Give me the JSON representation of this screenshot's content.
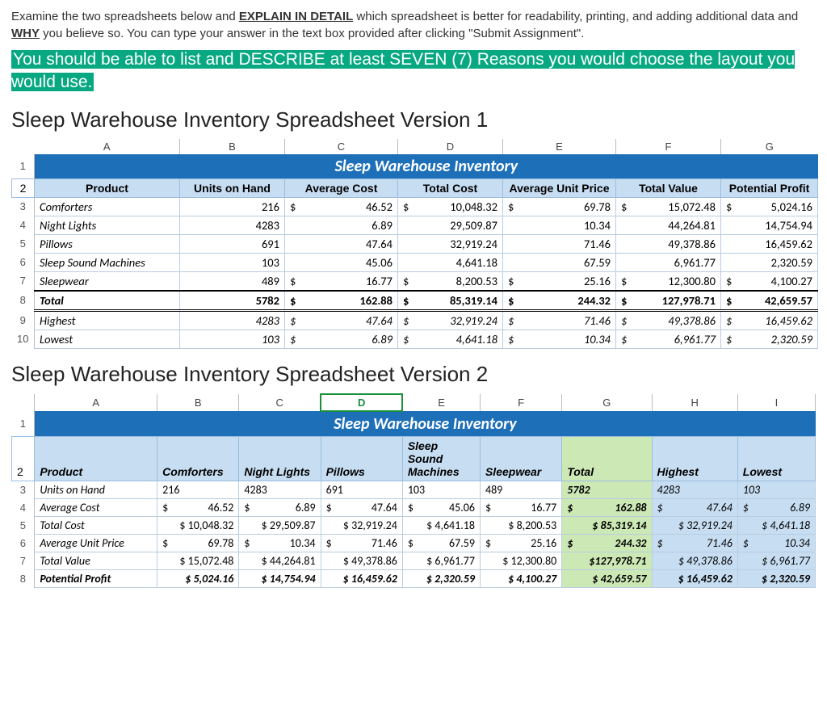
{
  "intro": {
    "p1a": "Examine the two spreadsheets below and ",
    "p1b": "EXPLAIN IN DETAIL",
    "p1c": " which spreadsheet is better for readability, printing, and adding additional data and ",
    "p1d": "WHY",
    "p1e": " you believe so. You can type your answer in the text box provided after clicking \"Submit Assignment\".",
    "hl": "You should be able to list and DESCRIBE at least SEVEN (7) Reasons you would choose the layout you would use."
  },
  "v1_heading": "Sleep Warehouse Inventory Spreadsheet Version 1",
  "v2_heading": "Sleep Warehouse Inventory Spreadsheet Version 2",
  "title": "Sleep Warehouse Inventory",
  "cols1": [
    "A",
    "B",
    "C",
    "D",
    "E",
    "F",
    "G"
  ],
  "cols2": [
    "A",
    "B",
    "C",
    "D",
    "E",
    "F",
    "G",
    "H",
    "I"
  ],
  "h1": {
    "product": "Product",
    "units": "Units on Hand",
    "avgcost": "Average Cost",
    "totalcost": "Total Cost",
    "avgprice": "Average Unit Price",
    "totalval": "Total Value",
    "profit": "Potential Profit"
  },
  "r3": {
    "n": "Comforters",
    "u": "216",
    "ac": "46.52",
    "tc": "10,048.32",
    "ap": "69.78",
    "tv": "15,072.48",
    "pp": "5,024.16"
  },
  "r4": {
    "n": "Night Lights",
    "u": "4283",
    "ac": "6.89",
    "tc": "29,509.87",
    "ap": "10.34",
    "tv": "44,264.81",
    "pp": "14,754.94"
  },
  "r5": {
    "n": "Pillows",
    "u": "691",
    "ac": "47.64",
    "tc": "32,919.24",
    "ap": "71.46",
    "tv": "49,378.86",
    "pp": "16,459.62"
  },
  "r6": {
    "n": "Sleep Sound Machines",
    "u": "103",
    "ac": "45.06",
    "tc": "4,641.18",
    "ap": "67.59",
    "tv": "6,961.77",
    "pp": "2,320.59"
  },
  "r7": {
    "n": "Sleepwear",
    "u": "489",
    "ac": "16.77",
    "tc": "8,200.53",
    "ap": "25.16",
    "tv": "12,300.80",
    "pp": "4,100.27"
  },
  "r8": {
    "n": "Total",
    "u": "5782",
    "ac": "162.88",
    "tc": "85,319.14",
    "ap": "244.32",
    "tv": "127,978.71",
    "pp": "42,659.57"
  },
  "r9": {
    "n": "Highest",
    "u": "4283",
    "ac": "47.64",
    "tc": "32,919.24",
    "ap": "71.46",
    "tv": "49,378.86",
    "pp": "16,459.62"
  },
  "r10": {
    "n": "Lowest",
    "u": "103",
    "ac": "6.89",
    "tc": "4,641.18",
    "ap": "10.34",
    "tv": "6,961.77",
    "pp": "2,320.59"
  },
  "dollar": "$",
  "h2": {
    "product": "Product",
    "c1": "Comforters",
    "c2": "Night Lights",
    "c3": "Pillows",
    "c4": "Sleep Sound Machines",
    "c5": "Sleepwear",
    "c6": "Total",
    "c7": "Highest",
    "c8": "Lowest"
  },
  "v2r3": {
    "n": "Units on Hand",
    "v": [
      "216",
      "4283",
      "691",
      "103",
      "489",
      "5782",
      "4283",
      "103"
    ]
  },
  "v2r4": {
    "n": "Average Cost",
    "v": [
      "46.52",
      "6.89",
      "47.64",
      "45.06",
      "16.77",
      "162.88",
      "47.64",
      "6.89"
    ]
  },
  "v2r5": {
    "n": "Total Cost",
    "v": [
      "$ 10,048.32",
      "$ 29,509.87",
      "$ 32,919.24",
      "$ 4,641.18",
      "$  8,200.53",
      "$  85,319.14",
      "$ 32,919.24",
      "$ 4,641.18"
    ]
  },
  "v2r6": {
    "n": "Average Unit Price",
    "v": [
      "69.78",
      "10.34",
      "71.46",
      "67.59",
      "25.16",
      "244.32",
      "71.46",
      "10.34"
    ]
  },
  "v2r7": {
    "n": "Total Value",
    "v": [
      "$ 15,072.48",
      "$ 44,264.81",
      "$ 49,378.86",
      "$ 6,961.77",
      "$ 12,300.80",
      "$127,978.71",
      "$ 49,378.86",
      "$ 6,961.77"
    ]
  },
  "v2r8": {
    "n": "Potential Profit",
    "v": [
      "$  5,024.16",
      "$ 14,754.94",
      "$ 16,459.62",
      "$ 2,320.59",
      "$  4,100.27",
      "$  42,659.57",
      "$ 16,459.62",
      "$ 2,320.59"
    ]
  }
}
